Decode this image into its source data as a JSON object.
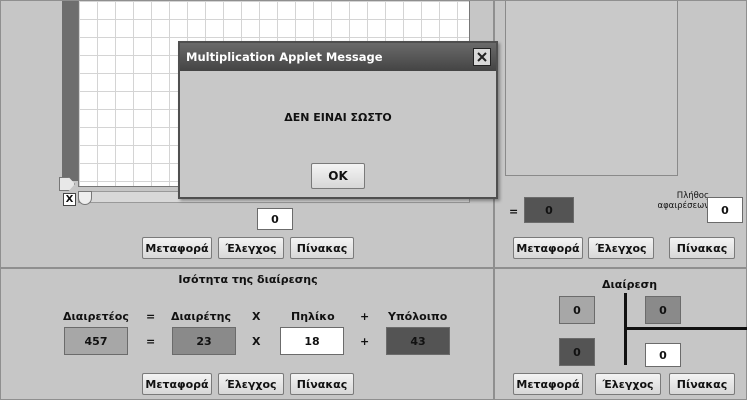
{
  "colors": {
    "dark_box": "#545454",
    "medium_box": "#8a8a8a",
    "light_box": "#a7a7a7",
    "white_box": "#ffffff",
    "dialog_title_bar": "#4f4f4f"
  },
  "grid_panel": {
    "counter_value": "0",
    "buttons": {
      "transfer": "Μεταφορά",
      "check": "Έλεγχος",
      "table": "Πίνακας"
    }
  },
  "subtraction_panel": {
    "result_label": "=",
    "result_value": "0",
    "count_label_line1": "Πλήθος",
    "count_label_line2": "αφαιρέσεων",
    "count_value": "0",
    "buttons": {
      "transfer": "Μεταφορά",
      "check": "Έλεγχος",
      "table": "Πίνακας"
    }
  },
  "equality_panel": {
    "title": "Ισότητα της διαίρεσης",
    "labels": {
      "dividend": "Διαιρετέος",
      "divisor": "Διαιρέτης",
      "quotient": "Πηλίκο",
      "remainder": "Υπόλοιπο"
    },
    "operators": {
      "eq1": "=",
      "eq2": "=",
      "times1": "X",
      "times2": "X",
      "plus1": "+",
      "plus2": "+"
    },
    "values": {
      "dividend": "457",
      "divisor": "23",
      "quotient": "18",
      "remainder": "43"
    },
    "buttons": {
      "transfer": "Μεταφορά",
      "check": "Έλεγχος",
      "table": "Πίνακας"
    }
  },
  "division_panel": {
    "title": "Διαίρεση",
    "dividend": "0",
    "divisor": "0",
    "remainder": "0",
    "quotient": "0",
    "buttons": {
      "transfer": "Μεταφορά",
      "check": "Έλεγχος",
      "table": "Πίνακας"
    }
  },
  "dialog": {
    "title": "Multiplication Applet Message",
    "message": "ΔΕΝ ΕΙΝΑΙ ΣΩΣΤΟ",
    "ok_label": "OK",
    "close_icon": "close-icon"
  },
  "slider_tools": {
    "x_label": "X"
  }
}
